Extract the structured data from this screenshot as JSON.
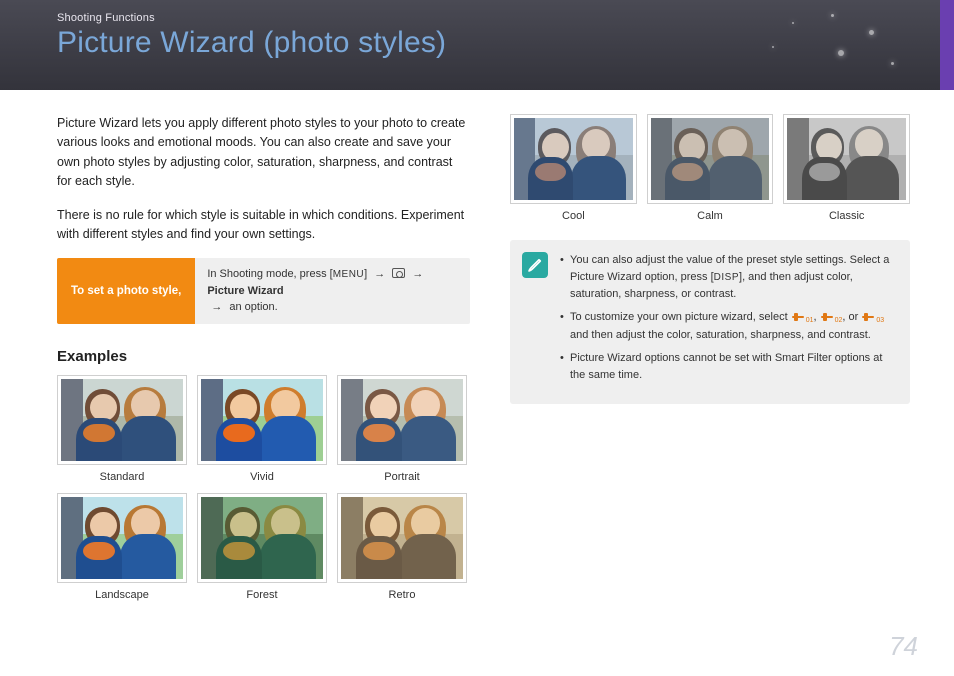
{
  "header": {
    "breadcrumb": "Shooting Functions",
    "title": "Picture Wizard (photo styles)"
  },
  "intro": {
    "p1": "Picture Wizard lets you apply different photo styles to your photo to create various looks and emotional moods. You can also create and save your own photo styles by adjusting color, saturation, sharpness, and contrast for each style.",
    "p2": "There is no rule for which style is suitable in which conditions. Experiment with different styles and find your own settings."
  },
  "set": {
    "button": "To set a photo style,",
    "lead": "In Shooting mode, press [",
    "menu": "MENU",
    "mid1": "] ",
    "arrow": "→",
    "bold": "Picture Wizard",
    "tail": " an option."
  },
  "examples_heading": "Examples",
  "left_thumbs": [
    {
      "label": "Standard",
      "cls": "p-standard"
    },
    {
      "label": "Vivid",
      "cls": "p-vivid"
    },
    {
      "label": "Portrait",
      "cls": "p-portrait"
    },
    {
      "label": "Landscape",
      "cls": "p-landscape"
    },
    {
      "label": "Forest",
      "cls": "p-forest"
    },
    {
      "label": "Retro",
      "cls": "p-retro"
    }
  ],
  "right_thumbs": [
    {
      "label": "Cool",
      "cls": "p-cool"
    },
    {
      "label": "Calm",
      "cls": "p-calm"
    },
    {
      "label": "Classic",
      "cls": "p-classic"
    }
  ],
  "info": {
    "b1a": "You can also adjust the value of the preset style settings. Select a Picture Wizard option, press [",
    "disp": "DISP",
    "b1b": "], and then adjust color, saturation, sharpness, or contrast.",
    "b2a": "To customize your own picture wizard, select ",
    "c1": "01",
    "c2": "02",
    "or": " or ",
    "c3": "03",
    "b2b": " and then adjust the color, saturation, sharpness, and contrast.",
    "b3": "Picture Wizard options cannot be set with Smart Filter options at the same time."
  },
  "page_number": "74"
}
